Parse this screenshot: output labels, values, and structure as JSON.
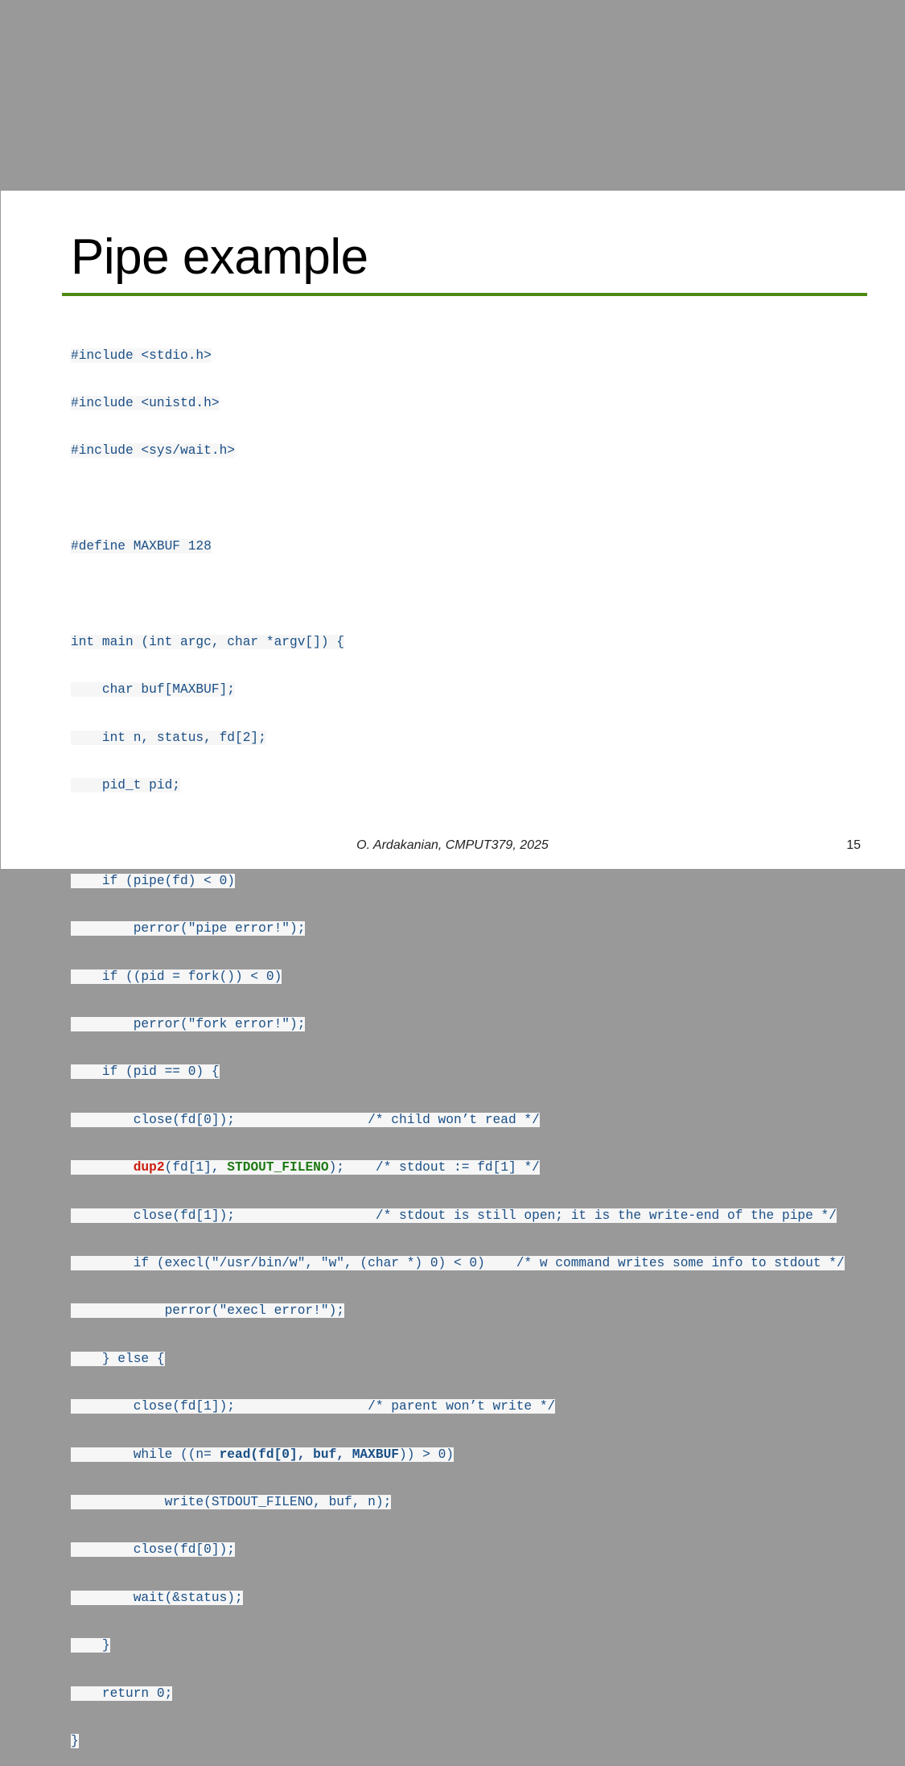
{
  "slide": {
    "title": "Pipe example",
    "footer": "O. Ardakanian, CMPUT379, 2025",
    "page_number": "15"
  },
  "code": {
    "l01": "#include <stdio.h>",
    "l02": "#include <unistd.h>",
    "l03": "#include <sys/wait.h>",
    "l05": "#define MAXBUF 128",
    "l07": "int main (int argc, char *argv[]) {",
    "l08": "    char buf[MAXBUF];",
    "l09": "    int n, status, fd[2];",
    "l10": "    pid_t pid;",
    "l12": "    if (pipe(fd) < 0)",
    "l13": "        perror(\"pipe error!\");",
    "l14": "    if ((pid = fork()) < 0)",
    "l15": "        perror(\"fork error!\");",
    "l16": "    if (pid == 0) {",
    "l17": "        close(fd[0]);                 /* child won’t read */",
    "l18_indent": "        ",
    "l18_dup2": "dup2",
    "l18_mid": "(fd[1], ",
    "l18_const": "STDOUT_FILENO",
    "l18_rest": ");    /* stdout := fd[1] */",
    "l19": "        close(fd[1]);                  /* stdout is still open; it is the write-end of the pipe */",
    "l20": "        if (execl(\"/usr/bin/w\", \"w\", (char *) 0) < 0)    /* w command writes some info to stdout */",
    "l21": "            perror(\"execl error!\");",
    "l22": "    } else {",
    "l23": "        close(fd[1]);                 /* parent won’t write */",
    "l24_pre": "        while ((n= ",
    "l24_bold": "read(fd[0], buf, MAXBUF",
    "l24_post": ")) > 0)",
    "l25": "            write(STDOUT_FILENO, buf, n);",
    "l26": "        close(fd[0]);",
    "l27": "        wait(&status);",
    "l28": "    }",
    "l29": "    return 0;",
    "l30": "}"
  },
  "colors": {
    "title_rule": "#4e8a10",
    "code_text": "#1a4f86",
    "dup2": "#cc1e10",
    "stdout_fileno": "#1e7a14"
  }
}
